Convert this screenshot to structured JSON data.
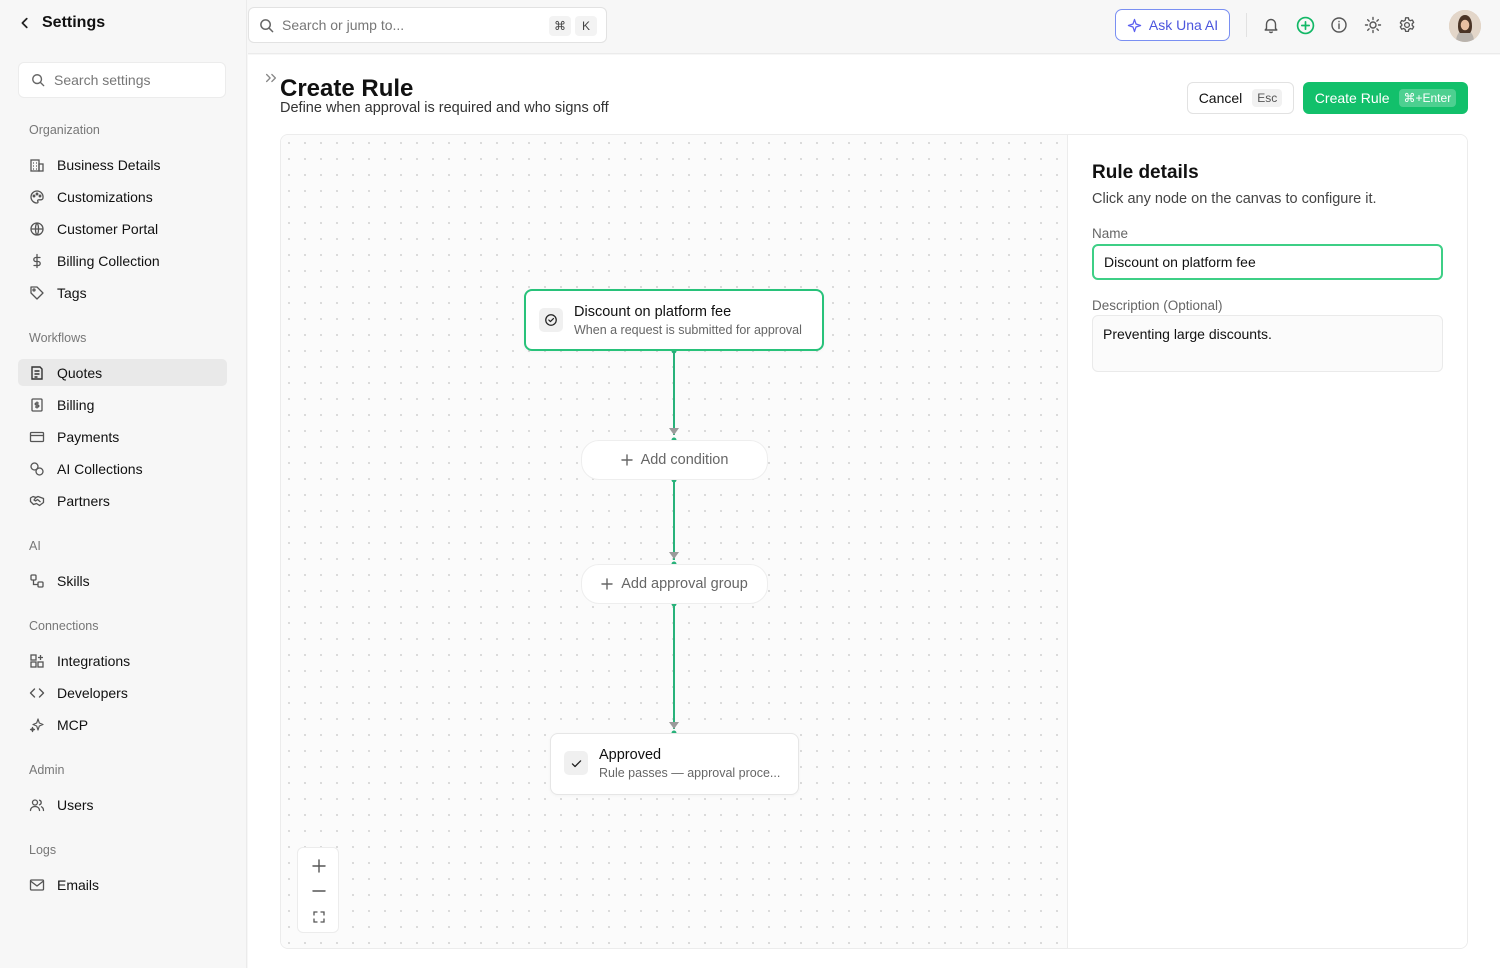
{
  "sidebar": {
    "back_label": "Settings",
    "search_placeholder": "Search settings",
    "sections": [
      {
        "title": "Organization",
        "items": [
          {
            "label": "Business Details",
            "icon": "building-icon"
          },
          {
            "label": "Customizations",
            "icon": "palette-icon"
          },
          {
            "label": "Customer Portal",
            "icon": "globe-icon"
          },
          {
            "label": "Billing Collection",
            "icon": "dollar-icon"
          },
          {
            "label": "Tags",
            "icon": "tag-icon"
          }
        ]
      },
      {
        "title": "Workflows",
        "items": [
          {
            "label": "Quotes",
            "icon": "quote-doc-icon",
            "active": true
          },
          {
            "label": "Billing",
            "icon": "billing-doc-icon"
          },
          {
            "label": "Payments",
            "icon": "credit-card-icon"
          },
          {
            "label": "AI Collections",
            "icon": "coins-icon"
          },
          {
            "label": "Partners",
            "icon": "handshake-icon"
          }
        ]
      },
      {
        "title": "AI",
        "items": [
          {
            "label": "Skills",
            "icon": "skills-icon"
          }
        ]
      },
      {
        "title": "Connections",
        "items": [
          {
            "label": "Integrations",
            "icon": "grid-plus-icon"
          },
          {
            "label": "Developers",
            "icon": "code-icon"
          },
          {
            "label": "MCP",
            "icon": "sparkles-icon"
          }
        ]
      },
      {
        "title": "Admin",
        "items": [
          {
            "label": "Users",
            "icon": "users-icon"
          }
        ]
      },
      {
        "title": "Logs",
        "items": [
          {
            "label": "Emails",
            "icon": "mail-icon"
          }
        ]
      }
    ]
  },
  "topbar": {
    "search_placeholder": "Search or jump to...",
    "shortcut_keys": [
      "⌘",
      "K"
    ],
    "ask_ai_label": "Ask Una AI",
    "accent_color": "#4b55dd"
  },
  "header": {
    "title": "Create Rule",
    "subtitle": "Define when approval is required and who signs off",
    "cancel_label": "Cancel",
    "cancel_shortcut": "Esc",
    "create_label": "Create Rule",
    "create_shortcut": "⌘+Enter",
    "primary_color": "#12c06b"
  },
  "canvas": {
    "trigger": {
      "title": "Discount on platform fee",
      "subtitle": "When a request is submitted for approval"
    },
    "add_condition_label": "Add condition",
    "add_approval_group_label": "Add approval group",
    "end": {
      "title": "Approved",
      "subtitle": "Rule passes — approval proce..."
    },
    "connector_color": "#28b27a"
  },
  "details": {
    "title": "Rule details",
    "subtitle": "Click any node on the canvas to configure it.",
    "name_label": "Name",
    "name_value": "Discount on platform fee",
    "description_label": "Description (Optional)",
    "description_value": "Preventing large discounts."
  }
}
